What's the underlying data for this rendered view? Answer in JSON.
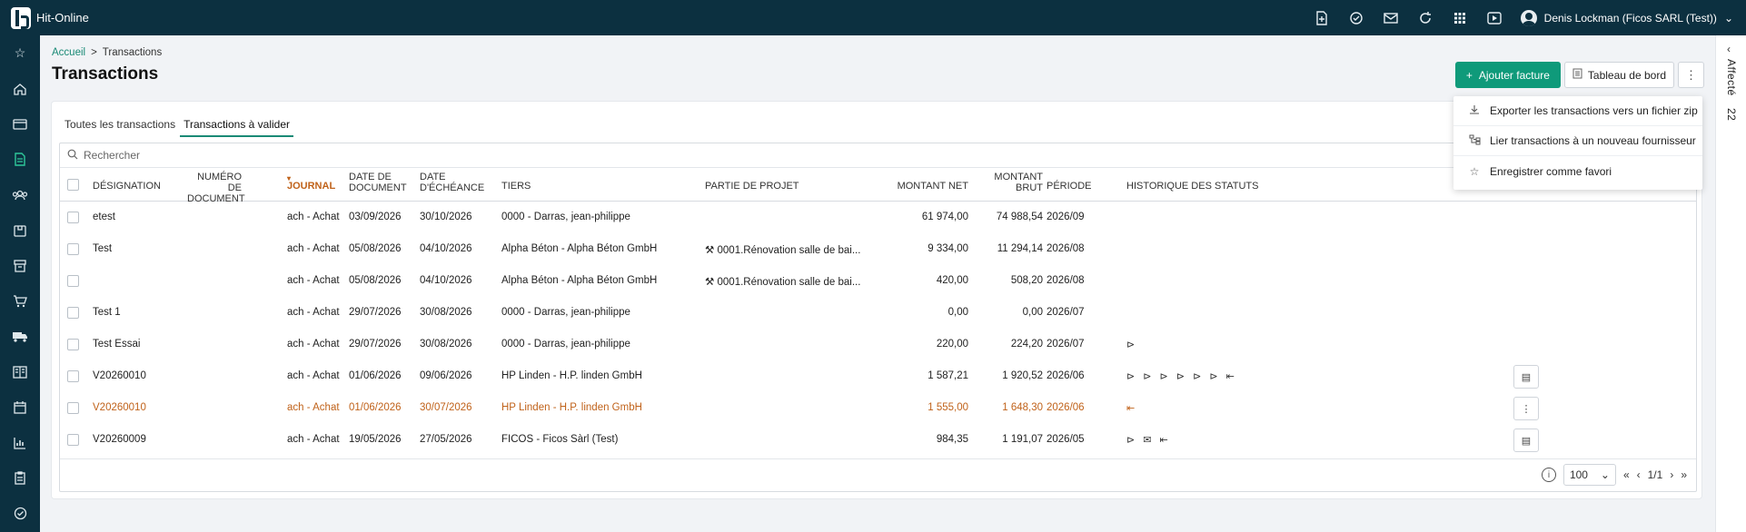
{
  "app": {
    "name": "Hit-Online"
  },
  "user": {
    "name": "Denis Lockman (Ficos SARL (Test))"
  },
  "breadcrumb": {
    "home": "Accueil",
    "separator": ">",
    "current": "Transactions"
  },
  "page": {
    "title": "Transactions"
  },
  "actions": {
    "add_invoice": "Ajouter facture",
    "dashboard": "Tableau de bord",
    "more": "⋮"
  },
  "menu": {
    "items": [
      {
        "label": "Exporter les transactions vers un fichier zip",
        "icon": "download-icon"
      },
      {
        "label": "Lier transactions à un nouveau fournisseur",
        "icon": "link-supplier-icon"
      },
      {
        "label": "Enregistrer comme favori",
        "icon": "star-icon"
      }
    ]
  },
  "tabs": [
    {
      "label": "Toutes les transactions",
      "active": false
    },
    {
      "label": "Transactions à valider",
      "active": true
    }
  ],
  "search": {
    "placeholder": "Rechercher"
  },
  "columns": {
    "designation": "Désignation",
    "doc_number_1": "Numéro de",
    "doc_number_2": "document",
    "journal": "Journal",
    "doc_date_1": "Date de",
    "doc_date_2": "document",
    "due_date_1": "Date",
    "due_date_2": "d'échéance",
    "third_party": "Tiers",
    "project_part": "Partie de projet",
    "net_amount": "Montant net",
    "gross_1": "Montant",
    "gross_2": "brut",
    "period": "Période",
    "status_history": "Historique des statuts"
  },
  "rows": [
    {
      "designation": "etest",
      "journal": "ach - Achat",
      "doc_date": "03/09/2026",
      "due_date": "30/10/2026",
      "tiers": "0000 - Darras, jean-philippe",
      "project": "",
      "net": "61 974,00",
      "gross": "74 988,54",
      "period": "2026/09",
      "status": "",
      "highlight": false,
      "action": ""
    },
    {
      "designation": "Test",
      "journal": "ach - Achat",
      "doc_date": "05/08/2026",
      "due_date": "04/10/2026",
      "tiers": "Alpha Béton - Alpha Béton GmbH",
      "project": "⚒ 0001.Rénovation salle de bai...",
      "net": "9 334,00",
      "gross": "11 294,14",
      "period": "2026/08",
      "status": "",
      "highlight": false,
      "action": ""
    },
    {
      "designation": "",
      "journal": "ach - Achat",
      "doc_date": "05/08/2026",
      "due_date": "04/10/2026",
      "tiers": "Alpha Béton - Alpha Béton GmbH",
      "project": "⚒ 0001.Rénovation salle de bai...",
      "net": "420,00",
      "gross": "508,20",
      "period": "2026/08",
      "status": "",
      "highlight": false,
      "action": ""
    },
    {
      "designation": "Test 1",
      "journal": "ach - Achat",
      "doc_date": "29/07/2026",
      "due_date": "30/08/2026",
      "tiers": "0000 - Darras, jean-philippe",
      "project": "",
      "net": "0,00",
      "gross": "0,00",
      "period": "2026/07",
      "status": "",
      "highlight": false,
      "action": ""
    },
    {
      "designation": "Test Essai",
      "journal": "ach - Achat",
      "doc_date": "29/07/2026",
      "due_date": "30/08/2026",
      "tiers": "0000 - Darras, jean-philippe",
      "project": "",
      "net": "220,00",
      "gross": "224,20",
      "period": "2026/07",
      "status": "⊳",
      "highlight": false,
      "action": ""
    },
    {
      "designation": "V20260010",
      "journal": "ach - Achat",
      "doc_date": "01/06/2026",
      "due_date": "09/06/2026",
      "tiers": "HP Linden - H.P. linden GmbH",
      "project": "",
      "net": "1 587,21",
      "gross": "1 920,52",
      "period": "2026/06",
      "status": "⊳ ⊳ ⊳ ⊳ ⊳ ⊳ ⇤",
      "highlight": false,
      "action": "▤"
    },
    {
      "designation": "V20260010",
      "journal": "ach - Achat",
      "doc_date": "01/06/2026",
      "due_date": "30/07/2026",
      "tiers": "HP Linden - H.P. linden GmbH",
      "project": "",
      "net": "1 555,00",
      "gross": "1 648,30",
      "period": "2026/06",
      "status": "⇤",
      "highlight": true,
      "action": "⋮"
    },
    {
      "designation": "V20260009",
      "journal": "ach - Achat",
      "doc_date": "19/05/2026",
      "due_date": "27/05/2026",
      "tiers": "FICOS - Ficos Sàrl (Test)",
      "project": "",
      "net": "984,35",
      "gross": "1 191,07",
      "period": "2026/05",
      "status": "⊳ ✉ ⇤",
      "highlight": false,
      "action": "▤"
    }
  ],
  "pagination": {
    "page_size": "100",
    "page_info": "1/1"
  },
  "right_panel": {
    "label": "Affecté",
    "count": "22"
  },
  "colors": {
    "topbar": "#0c3040",
    "accent": "#0f9a7a",
    "highlight": "#c0621a"
  }
}
